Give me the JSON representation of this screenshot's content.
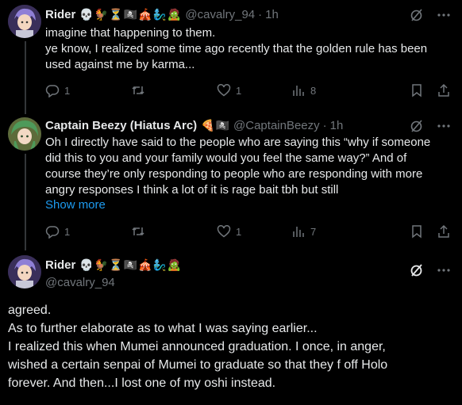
{
  "tweets": [
    {
      "name": "Rider",
      "emojis": "💀🐓⏳🏴‍☠️🎪🧞‍♂️🧟",
      "handle": "@cavalry_94",
      "time": "1h",
      "lines": [
        "imagine that happening to them.",
        "ye know, I realized some time ago recently that the golden rule has been",
        "used against me by karma..."
      ],
      "reply_count": "1",
      "retweet_count": "",
      "like_count": "1",
      "view_count": "8"
    },
    {
      "name": "Captain Beezy (Hiatus Arc)",
      "emojis": "🍕🏴‍☠️",
      "handle": "@CaptainBeezy",
      "time": "1h",
      "lines": [
        "Oh I directly have said to the people who are saying this “why if someone",
        "did this to you and your family would you feel the same way?” And of",
        "course they’re only responding to people who are responding with more",
        "angry responses I think a lot of it is rage bait tbh but still"
      ],
      "show_more": "Show more",
      "reply_count": "1",
      "retweet_count": "",
      "like_count": "1",
      "view_count": "7"
    }
  ],
  "focused": {
    "name": "Rider",
    "emojis": "💀🐓⏳🏴‍☠️🎪🧞‍♂️🧟",
    "handle": "@cavalry_94",
    "lines": [
      "agreed.",
      "As to further elaborate as to what I was saying earlier...",
      "I realized this when Mumei announced graduation. I once, in anger,",
      "wished a certain senpai of Mumei to graduate so that they f off Holo",
      "forever. And then...I lost one of my oshi instead."
    ]
  },
  "icons": {
    "grok": "grok-icon",
    "more": "more-icon",
    "reply": "reply-icon",
    "retweet": "retweet-icon",
    "like": "like-icon",
    "views": "views-icon",
    "bookmark": "bookmark-icon",
    "share": "share-icon"
  },
  "colors": {
    "background": "#000000",
    "text": "#e7e9ea",
    "muted": "#71767b",
    "link": "#1d9bf0",
    "line": "#333639"
  }
}
